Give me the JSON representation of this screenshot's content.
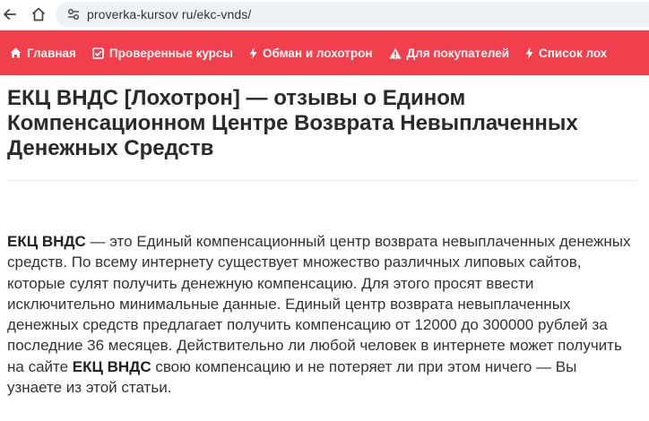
{
  "browser": {
    "url": "proverka-kursov ru/ekc-vnds/"
  },
  "nav": {
    "items": [
      {
        "label": "Главная",
        "icon": "home-icon"
      },
      {
        "label": "Проверенные курсы",
        "icon": "check-square-icon"
      },
      {
        "label": "Обман и лохотрон",
        "icon": "bolt-icon"
      },
      {
        "label": "Для покупателей",
        "icon": "warning-icon"
      },
      {
        "label": "Список лох",
        "icon": "bolt-icon"
      }
    ],
    "bg_color": "#f0404e"
  },
  "article": {
    "title": "ЕКЦ ВНДС [Лохотрон] — отзывы о Едином Компенсационном Центре Возврата Невыплаченных Денежных Средств",
    "intro_bold_1": "ЕКЦ ВНДС",
    "intro_text_1": " — это Единый компенсационный центр возврата невыплаченных денежных средств. По всему интернету существует множество различных липовых сайтов, которые сулят получить денежную компенсацию. Для этого просят ввести исключительно минимальные данные. Единый центр возврата невыплаченных денежных средств предлагает получить компенсацию от 12000 до 300000 рублей за последние 36 месяцев. Действительно ли любой человек в интернете может получить на сайте ",
    "intro_bold_2": "ЕКЦ ВНДС",
    "intro_text_2": " свою компенсацию и не потеряет ли при этом ничего — Вы узнаете из этой статьи."
  }
}
